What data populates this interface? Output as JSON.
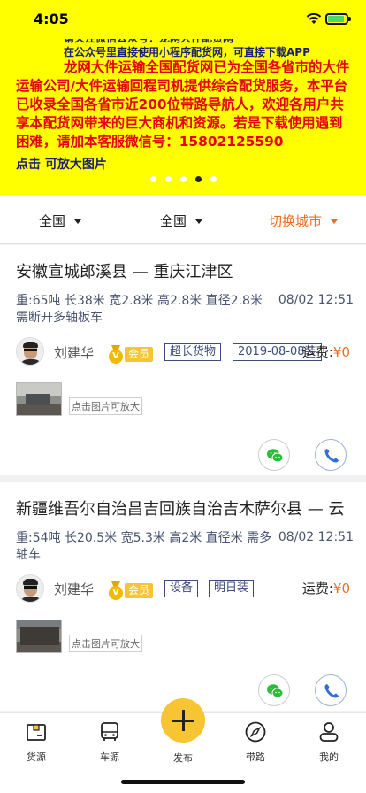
{
  "status_bar": {
    "time": "4:05"
  },
  "banner": {
    "notice_line1": "请关注微信公众号：龙网大件配货网",
    "notice_line2": "在公众号里直接使用小程序配货网，可直接下载APP",
    "main_text": "龙网大件运输全国配货网已为全国各省市的大件运输公司/大件运输回程司机提供综合配货服务，本平台已收录全国各省市近200位带路导航人，欢迎各用户共享本配货网带来的巨大商机和资源。若是下载使用遇到困难，请加本客服微信号：",
    "wechat_id": "15802125590",
    "tap_hint": "点击 可放大图片",
    "slide_count": 5,
    "active_slide": 4
  },
  "filters": {
    "origin": "全国",
    "destination": "全国",
    "switch_city": "切换城市"
  },
  "listings": [
    {
      "route": "安徽宣城郎溪县 — 重庆江津区",
      "specs": "重:65吨 长38米 宽2.8米 高2.8米 直径2.8米 需断开多轴板车",
      "posted": "08/02 12:51",
      "user": "刘建华",
      "member_label": "会员",
      "tags": [
        "超长货物",
        "2019-08-08装"
      ],
      "fee_label": "运费:",
      "fee_value": "¥0",
      "photo_hint": "点击图片可放大"
    },
    {
      "route": "新疆维吾尔自治昌吉回族自治吉木萨尔县 — 云",
      "specs": "重:54吨 长20.5米 宽5.3米 高2米 直径米 需多轴车",
      "posted": "08/02 12:51",
      "user": "刘建华",
      "member_label": "会员",
      "tags": [
        "设备",
        "明日装"
      ],
      "fee_label": "运费:",
      "fee_value": "¥0",
      "photo_hint": "点击图片可放大"
    }
  ],
  "tabbar": {
    "tabs": [
      {
        "label": "货源",
        "icon": "cargo-box-icon"
      },
      {
        "label": "车源",
        "icon": "truck-icon"
      },
      {
        "label": "发布",
        "icon": "plus-icon"
      },
      {
        "label": "带路",
        "icon": "compass-icon"
      },
      {
        "label": "我的",
        "icon": "person-icon"
      }
    ]
  },
  "colors": {
    "banner_bg": "#ffff00",
    "banner_red": "#e60012",
    "accent_orange": "#ef6c20",
    "member_gold": "#f7c533",
    "wechat_green": "#2dbb3b",
    "phone_blue": "#2f6fdc"
  }
}
